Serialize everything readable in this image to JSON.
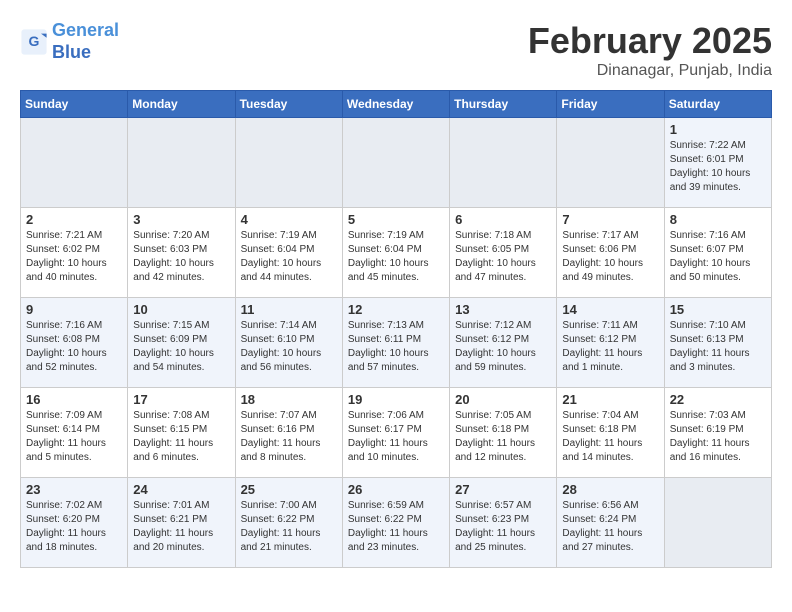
{
  "header": {
    "logo_line1": "General",
    "logo_line2": "Blue",
    "title": "February 2025",
    "subtitle": "Dinanagar, Punjab, India"
  },
  "days_of_week": [
    "Sunday",
    "Monday",
    "Tuesday",
    "Wednesday",
    "Thursday",
    "Friday",
    "Saturday"
  ],
  "weeks": [
    [
      {
        "day": "",
        "info": ""
      },
      {
        "day": "",
        "info": ""
      },
      {
        "day": "",
        "info": ""
      },
      {
        "day": "",
        "info": ""
      },
      {
        "day": "",
        "info": ""
      },
      {
        "day": "",
        "info": ""
      },
      {
        "day": "1",
        "info": "Sunrise: 7:22 AM\nSunset: 6:01 PM\nDaylight: 10 hours and 39 minutes."
      }
    ],
    [
      {
        "day": "2",
        "info": "Sunrise: 7:21 AM\nSunset: 6:02 PM\nDaylight: 10 hours and 40 minutes."
      },
      {
        "day": "3",
        "info": "Sunrise: 7:20 AM\nSunset: 6:03 PM\nDaylight: 10 hours and 42 minutes."
      },
      {
        "day": "4",
        "info": "Sunrise: 7:19 AM\nSunset: 6:04 PM\nDaylight: 10 hours and 44 minutes."
      },
      {
        "day": "5",
        "info": "Sunrise: 7:19 AM\nSunset: 6:04 PM\nDaylight: 10 hours and 45 minutes."
      },
      {
        "day": "6",
        "info": "Sunrise: 7:18 AM\nSunset: 6:05 PM\nDaylight: 10 hours and 47 minutes."
      },
      {
        "day": "7",
        "info": "Sunrise: 7:17 AM\nSunset: 6:06 PM\nDaylight: 10 hours and 49 minutes."
      },
      {
        "day": "8",
        "info": "Sunrise: 7:16 AM\nSunset: 6:07 PM\nDaylight: 10 hours and 50 minutes."
      }
    ],
    [
      {
        "day": "9",
        "info": "Sunrise: 7:16 AM\nSunset: 6:08 PM\nDaylight: 10 hours and 52 minutes."
      },
      {
        "day": "10",
        "info": "Sunrise: 7:15 AM\nSunset: 6:09 PM\nDaylight: 10 hours and 54 minutes."
      },
      {
        "day": "11",
        "info": "Sunrise: 7:14 AM\nSunset: 6:10 PM\nDaylight: 10 hours and 56 minutes."
      },
      {
        "day": "12",
        "info": "Sunrise: 7:13 AM\nSunset: 6:11 PM\nDaylight: 10 hours and 57 minutes."
      },
      {
        "day": "13",
        "info": "Sunrise: 7:12 AM\nSunset: 6:12 PM\nDaylight: 10 hours and 59 minutes."
      },
      {
        "day": "14",
        "info": "Sunrise: 7:11 AM\nSunset: 6:12 PM\nDaylight: 11 hours and 1 minute."
      },
      {
        "day": "15",
        "info": "Sunrise: 7:10 AM\nSunset: 6:13 PM\nDaylight: 11 hours and 3 minutes."
      }
    ],
    [
      {
        "day": "16",
        "info": "Sunrise: 7:09 AM\nSunset: 6:14 PM\nDaylight: 11 hours and 5 minutes."
      },
      {
        "day": "17",
        "info": "Sunrise: 7:08 AM\nSunset: 6:15 PM\nDaylight: 11 hours and 6 minutes."
      },
      {
        "day": "18",
        "info": "Sunrise: 7:07 AM\nSunset: 6:16 PM\nDaylight: 11 hours and 8 minutes."
      },
      {
        "day": "19",
        "info": "Sunrise: 7:06 AM\nSunset: 6:17 PM\nDaylight: 11 hours and 10 minutes."
      },
      {
        "day": "20",
        "info": "Sunrise: 7:05 AM\nSunset: 6:18 PM\nDaylight: 11 hours and 12 minutes."
      },
      {
        "day": "21",
        "info": "Sunrise: 7:04 AM\nSunset: 6:18 PM\nDaylight: 11 hours and 14 minutes."
      },
      {
        "day": "22",
        "info": "Sunrise: 7:03 AM\nSunset: 6:19 PM\nDaylight: 11 hours and 16 minutes."
      }
    ],
    [
      {
        "day": "23",
        "info": "Sunrise: 7:02 AM\nSunset: 6:20 PM\nDaylight: 11 hours and 18 minutes."
      },
      {
        "day": "24",
        "info": "Sunrise: 7:01 AM\nSunset: 6:21 PM\nDaylight: 11 hours and 20 minutes."
      },
      {
        "day": "25",
        "info": "Sunrise: 7:00 AM\nSunset: 6:22 PM\nDaylight: 11 hours and 21 minutes."
      },
      {
        "day": "26",
        "info": "Sunrise: 6:59 AM\nSunset: 6:22 PM\nDaylight: 11 hours and 23 minutes."
      },
      {
        "day": "27",
        "info": "Sunrise: 6:57 AM\nSunset: 6:23 PM\nDaylight: 11 hours and 25 minutes."
      },
      {
        "day": "28",
        "info": "Sunrise: 6:56 AM\nSunset: 6:24 PM\nDaylight: 11 hours and 27 minutes."
      },
      {
        "day": "",
        "info": ""
      }
    ]
  ]
}
